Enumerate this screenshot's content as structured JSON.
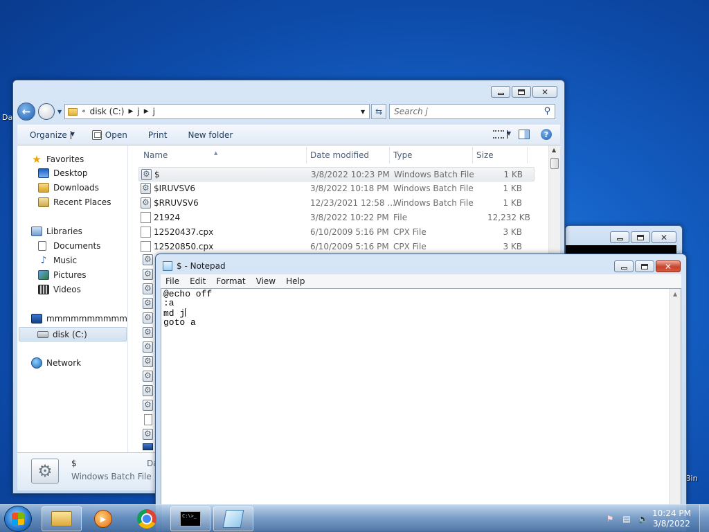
{
  "desktop": {
    "left_label": "Da",
    "right_label": "Bin"
  },
  "explorer": {
    "address": {
      "root": "disk (C:)",
      "parts": [
        "j",
        "j"
      ]
    },
    "search_placeholder": "Search j",
    "toolbar": {
      "organize": "Organize",
      "open": "Open",
      "print": "Print",
      "new_folder": "New folder"
    },
    "columns": {
      "name": "Name",
      "date": "Date modified",
      "type": "Type",
      "size": "Size"
    },
    "nav": {
      "favorites": "Favorites",
      "desktop": "Desktop",
      "downloads": "Downloads",
      "recent": "Recent Places",
      "libraries": "Libraries",
      "documents": "Documents",
      "music": "Music",
      "pictures": "Pictures",
      "videos": "Videos",
      "computer": "mmmmmmmmmmmm",
      "disk": "disk (C:)",
      "network": "Network"
    },
    "files": [
      {
        "name": "$",
        "date": "3/8/2022 10:23 PM",
        "type": "Windows Batch File",
        "size": "1 KB"
      },
      {
        "name": "$IRUVSV6",
        "date": "3/8/2022 10:18 PM",
        "type": "Windows Batch File",
        "size": "1 KB"
      },
      {
        "name": "$RRUVSV6",
        "date": "12/23/2021 12:58 ...",
        "type": "Windows Batch File",
        "size": "1 KB"
      },
      {
        "name": "21924",
        "date": "3/8/2022 10:22 PM",
        "type": "File",
        "size": "12,232 KB"
      },
      {
        "name": "12520437.cpx",
        "date": "6/10/2009 5:16 PM",
        "type": "CPX File",
        "size": "3 KB"
      },
      {
        "name": "12520850.cpx",
        "date": "6/10/2009 5:16 PM",
        "type": "CPX File",
        "size": "3 KB"
      }
    ],
    "details": {
      "name": "$",
      "type": "Windows Batch File",
      "extra": "Da"
    }
  },
  "notepad": {
    "title": "$ - Notepad",
    "menu": [
      "File",
      "Edit",
      "Format",
      "View",
      "Help"
    ],
    "lines": [
      "@echo off",
      ":a",
      "md j",
      "goto a"
    ]
  },
  "taskbar": {
    "time": "10:24 PM",
    "date": "3/8/2022",
    "cmd_icon_text": "C:\\>_"
  }
}
